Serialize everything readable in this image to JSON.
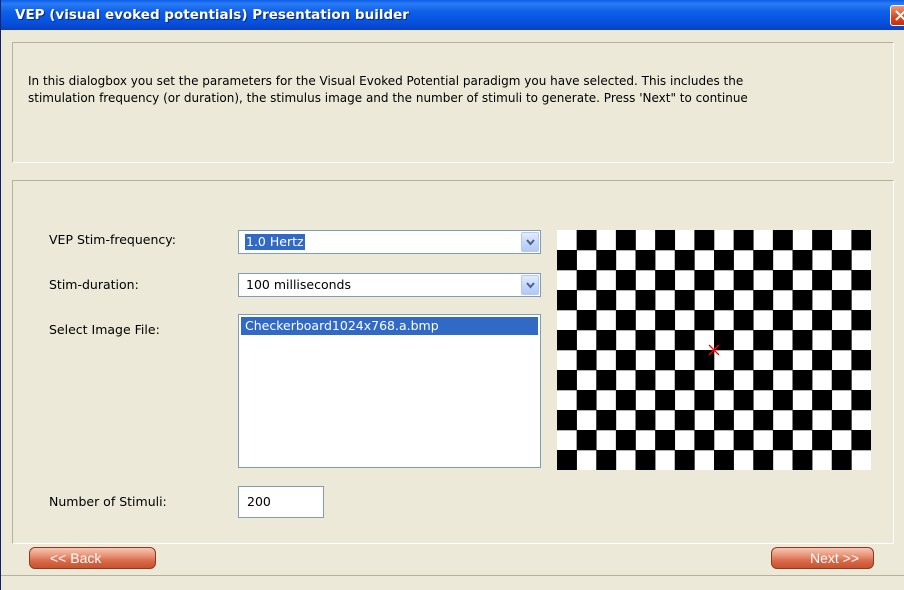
{
  "window": {
    "title": "VEP (visual evoked potentials) Presentation builder"
  },
  "info": {
    "line1": "In this dialogbox you set the parameters for the Visual Evoked Potential paradigm you have selected. This includes the",
    "line2": "stimulation frequency (or duration), the stimulus image and the number of stimuli to generate. Press 'Next\" to continue"
  },
  "form": {
    "frequency": {
      "label": "VEP Stim-frequency:",
      "value": "1.0 Hertz"
    },
    "duration": {
      "label": "Stim-duration:",
      "value": "100 milliseconds"
    },
    "image_file": {
      "label": "Select Image File:",
      "items": [
        "Checkerboard1024x768.a.bmp"
      ],
      "selected_index": 0
    },
    "stimuli": {
      "label": "Number of Stimuli:",
      "value": "200"
    }
  },
  "preview": {
    "image": "checkerboard",
    "columns": 16,
    "rows": 12,
    "fixation_mark": "red-x",
    "colors": {
      "dark": "#000000",
      "light": "#ffffff",
      "mark": "#ff0000"
    }
  },
  "buttons": {
    "back": "<< Back",
    "next": "Next >>"
  },
  "colors": {
    "title_bar": "#0a5ce8",
    "selection": "#316ac5",
    "button": "#d9694a",
    "background": "#ece9d8"
  }
}
